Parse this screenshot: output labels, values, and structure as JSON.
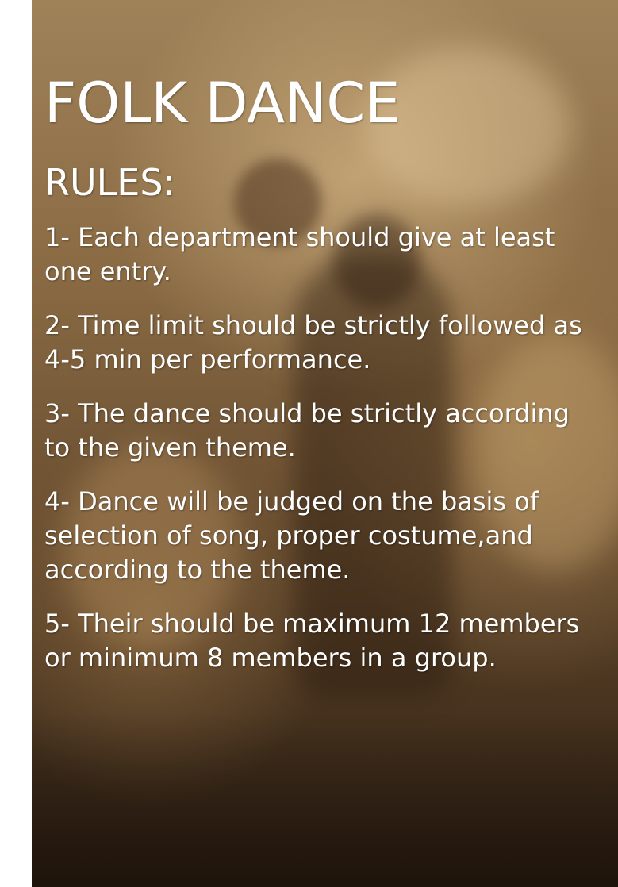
{
  "poster": {
    "title": "FOLK DANCE",
    "subtitle": "RULES:",
    "rules": [
      "1- Each department should give at least one entry.",
      "2- Time limit should be strictly followed as 4-5 min per performance.",
      "3- The dance should be strictly according to the given theme.",
      "4- Dance will be judged on the basis of selection of song, proper costume,and according to the theme.",
      "5- Their should be maximum 12 members or minimum 8 members in a group."
    ]
  },
  "colors": {
    "text": "#ffffff",
    "background_tone": "#8a6b44",
    "dark_tone": "#2a1d12"
  }
}
